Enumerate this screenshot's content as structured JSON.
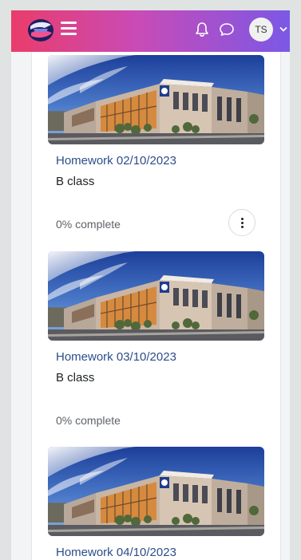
{
  "header": {
    "logo_icon": "institution-logo-icon",
    "menu_icon": "hamburger-menu-icon",
    "notifications_icon": "bell-icon",
    "messages_icon": "chat-bubble-icon",
    "user_initials": "TS",
    "user_menu_icon": "chevron-down-icon",
    "gradient_colors": [
      "#ea3c6b",
      "#c94bb6",
      "#7b58e6"
    ]
  },
  "courses": [
    {
      "title": "Homework 02/10/2023",
      "category": "B class",
      "progress_text": "0% complete",
      "progress_percent": 0,
      "has_actions_menu": true
    },
    {
      "title": "Homework 03/10/2023",
      "category": "B class",
      "progress_text": "0% complete",
      "progress_percent": 0,
      "has_actions_menu": false
    },
    {
      "title": "Homework 04/10/2023",
      "category": "",
      "progress_text": "",
      "progress_percent": 0,
      "has_actions_menu": false
    }
  ],
  "colors": {
    "link": "#2c4d8a",
    "text": "#1d2125",
    "muted": "#5d636a"
  }
}
